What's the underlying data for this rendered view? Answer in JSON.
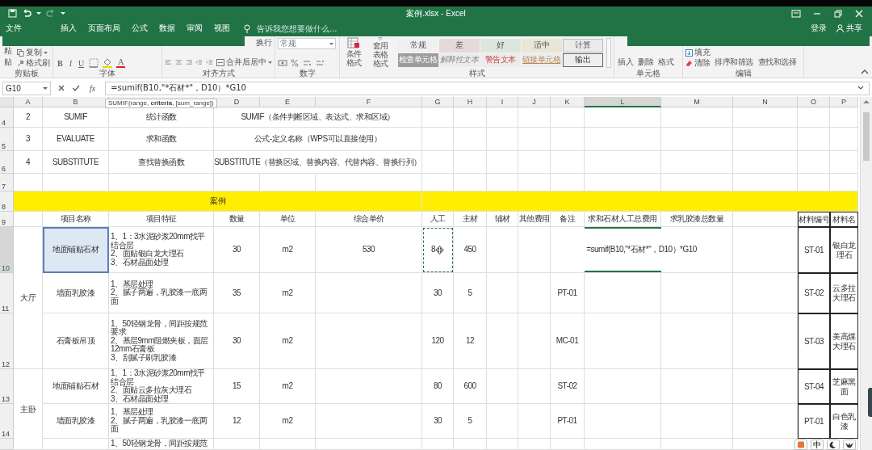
{
  "title_bar": {
    "title": "案例.xlsx - Excel"
  },
  "menu_tabs": [
    {
      "label": "文件",
      "selected": false
    },
    {
      "label": "插入",
      "selected": false
    },
    {
      "label": "页面布局",
      "selected": false
    },
    {
      "label": "公式",
      "selected": false
    },
    {
      "label": "数据",
      "selected": false
    },
    {
      "label": "审阅",
      "selected": false
    },
    {
      "label": "视图",
      "selected": false
    }
  ],
  "tell_me": {
    "placeholder": "告诉我您想要做什么..."
  },
  "account": {
    "sign_in": "登录",
    "share": "共享"
  },
  "ribbon": {
    "clipboard": {
      "label": "剪贴板",
      "paste": "粘贴",
      "copy": "复制",
      "format_painter": "格式刷"
    },
    "font": {
      "label": "字体",
      "bold": "B",
      "italic": "I",
      "underline": "U",
      "font_color": "A"
    },
    "alignment": {
      "label": "对齐方式",
      "wrap_text": "换行",
      "merge_center": "合并后居中"
    },
    "number": {
      "label": "数字",
      "format": "常规"
    },
    "styles": {
      "label": "样式",
      "conditional_formatting": "条件格式",
      "format_as_table": "套用表格格式",
      "gallery": [
        {
          "label": "常规",
          "kind": "normal"
        },
        {
          "label": "差",
          "kind": "bad"
        },
        {
          "label": "好",
          "kind": "good"
        },
        {
          "label": "适中",
          "kind": "neutral"
        },
        {
          "label": "计算",
          "kind": "calculation"
        },
        {
          "label": "检查单元格",
          "kind": "check"
        },
        {
          "label": "解释性文本",
          "kind": "explanatory"
        },
        {
          "label": "警告文本",
          "kind": "warning"
        },
        {
          "label": "链接单元格",
          "kind": "linked"
        },
        {
          "label": "输出",
          "kind": "output"
        }
      ]
    },
    "cells": {
      "label": "单元格",
      "insert": "插入",
      "delete": "删除",
      "format": "格式"
    },
    "editing": {
      "label": "编辑",
      "fill": "填充",
      "clear": "清除",
      "sort_filter": "排序和筛选",
      "find_select": "查找和选择"
    }
  },
  "formula_bar": {
    "name_box": "G10",
    "function_button": "fx",
    "formula": "=sumif(B10,\"*石材*\"，D10）*G10"
  },
  "tooltip": {
    "text": "SUMIF(range, **criteria**, [sum_range])"
  },
  "sheet": {
    "columns": [
      {
        "label": "A",
        "selected": false
      },
      {
        "label": "B",
        "selected": false
      },
      {
        "selected": false
      },
      {
        "label": "D",
        "selected": false
      },
      {
        "label": "E",
        "selected": false
      },
      {
        "label": "F",
        "selected": false
      },
      {
        "label": "G",
        "selected": false
      },
      {
        "label": "H",
        "selected": false
      },
      {
        "label": "I",
        "selected": false
      },
      {
        "label": "J",
        "selected": false
      },
      {
        "label": "K",
        "selected": false
      },
      {
        "label": "L",
        "selected": true
      },
      {
        "label": "M",
        "selected": false
      },
      {
        "label": "N",
        "selected": false
      },
      {
        "label": "O",
        "selected": false
      },
      {
        "label": "P",
        "selected": false
      }
    ],
    "rows": [
      {
        "number": "4",
        "selected": false,
        "cells": {
          "A4": {
            "text": "2"
          },
          "B4": {
            "text": "SUMIF"
          },
          "C4": {
            "text": "统计函数"
          },
          "D4:F4": {
            "text": "SUMIF（条件判断区域、表达式、求和区域）"
          }
        }
      },
      {
        "number": "5",
        "selected": false,
        "cells": {
          "A5": {
            "text": "3"
          },
          "B5": {
            "text": "EVALUATE"
          },
          "C5": {
            "text": "求和函数"
          },
          "D5:F5": {
            "text": "公式-定义名称（WPS可以直接使用）"
          }
        }
      },
      {
        "number": "6",
        "selected": false,
        "cells": {
          "A6": {
            "text": "4"
          },
          "B6": {
            "text": "SUBSTITUTE"
          },
          "C6": {
            "text": "查找替换函数"
          },
          "D6:F6": {
            "text": "SUBSTITUTE（替换区域、替换内容、代替内容、替换行列）"
          }
        }
      },
      {
        "number": "7",
        "selected": false
      },
      {
        "number": "8",
        "selected": false,
        "cells": {
          "A8:F8": {
            "text": "案例",
            "color": "#ffee00"
          },
          "G8:P8": {
            "color": "#ffee00"
          }
        }
      },
      {
        "number": "9",
        "selected": false,
        "cells": {
          "B9": {
            "text": "项目名称"
          },
          "C9": {
            "text": "项目特征"
          },
          "D9": {
            "text": "数量"
          },
          "E9": {
            "text": "单位"
          },
          "F9": {
            "text": "综合单价"
          },
          "G9": {
            "text": "人工"
          },
          "H9": {
            "text": "主材"
          },
          "I9": {
            "text": "辅材"
          },
          "J9": {
            "text": "其他费用"
          },
          "K9": {
            "text": "备注"
          },
          "L9": {
            "text": "求和石材人工总费用"
          },
          "M9": {
            "text": "求乳胶漆总数量"
          },
          "O9": {
            "text": "材料编号",
            "boxed": true
          },
          "P9": {
            "text": "材料名",
            "boxed": true
          }
        }
      },
      {
        "number": "10",
        "selected": true,
        "cells": {
          "A10:A12": {
            "text": "大厅"
          },
          "B10": {
            "text": "地面铺贴石材",
            "referenced": true
          },
          "C10": {
            "lines": [
              "1、1：3水泥砂浆20mm找平结合层",
              "2、面贴银白龙大理石",
              "3、石材晶面处理"
            ]
          },
          "D10": {
            "text": "30"
          },
          "E10": {
            "text": "m2"
          },
          "F10": {
            "text": "530"
          },
          "G10": {
            "text": "8",
            "copy_marquee": true
          },
          "H10": {
            "text": "450"
          },
          "K10:M10": {
            "text": "=sumif(B10,\"*石材*\"，D10）*G10",
            "editing": true
          },
          "O10": {
            "text": "ST-01",
            "boxed": true
          },
          "P10": {
            "text": "银白龙理石",
            "boxed": true
          }
        }
      },
      {
        "number": "11",
        "selected": false,
        "cells": {
          "B11": {
            "text": "墙面乳胶漆"
          },
          "C11": {
            "lines": [
              "1、基层处理",
              "2、腻子两遍，乳胶漆一底两面"
            ]
          },
          "D11": {
            "text": "35"
          },
          "E11": {
            "text": "m2"
          },
          "G11": {
            "text": "30"
          },
          "H11": {
            "text": "5"
          },
          "K11": {
            "text": "PT-01"
          },
          "O11": {
            "text": "ST-02",
            "boxed": true
          },
          "P11": {
            "text": "云多拉大理石",
            "boxed": true
          }
        }
      },
      {
        "number": "12",
        "selected": false,
        "cells": {
          "B12": {
            "text": "石膏板吊顶"
          },
          "C12": {
            "lines": [
              "1、50轻钢龙骨，间距按规范要求",
              "2、基层9mm阻燃夹板，面层12mm石膏板",
              "3、刮腻子刷乳胶漆"
            ]
          },
          "D12": {
            "text": "30"
          },
          "E12": {
            "text": "m2"
          },
          "G12": {
            "text": "120"
          },
          "H12": {
            "text": "12"
          },
          "K12": {
            "text": "MC-01"
          },
          "O12": {
            "text": "ST-03",
            "boxed": true
          },
          "P12": {
            "text": "美高煤大理石",
            "boxed": true
          }
        }
      },
      {
        "number": "13",
        "selected": false,
        "cells": {
          "A13:A15": {
            "text": "主卧"
          },
          "B13": {
            "text": "地面铺贴石材"
          },
          "C13": {
            "lines": [
              "1、1：3水泥砂浆20mm找平结合层",
              "2、面贴云多拉灰大理石",
              "3、石材晶面处理"
            ]
          },
          "D13": {
            "text": "15"
          },
          "E13": {
            "text": "m2"
          },
          "G13": {
            "text": "80"
          },
          "H13": {
            "text": "600"
          },
          "K13": {
            "text": "ST-02"
          },
          "O13": {
            "text": "ST-04",
            "boxed": true
          },
          "P13": {
            "text": "芝麻黑面",
            "boxed": true
          }
        }
      },
      {
        "number": "14",
        "selected": false,
        "cells": {
          "B14": {
            "text": "墙面乳胶漆"
          },
          "C14": {
            "lines": [
              "1、基层处理",
              "2、腻子两遍，乳胶漆一底两面"
            ]
          },
          "D14": {
            "text": "12"
          },
          "E14": {
            "text": "m2"
          },
          "G14": {
            "text": "30"
          },
          "H14": {
            "text": "5"
          },
          "K14": {
            "text": "PT-01"
          },
          "O14": {
            "text": "PT-01",
            "boxed": true
          },
          "P14": {
            "text": "白色乳漆",
            "boxed": true
          }
        }
      },
      {
        "selected": false,
        "cells": {
          "C15": {
            "lines": [
              "1、50轻钢龙骨，间距按规范"
            ]
          }
        }
      }
    ]
  },
  "tray": {
    "input_method": "中"
  }
}
